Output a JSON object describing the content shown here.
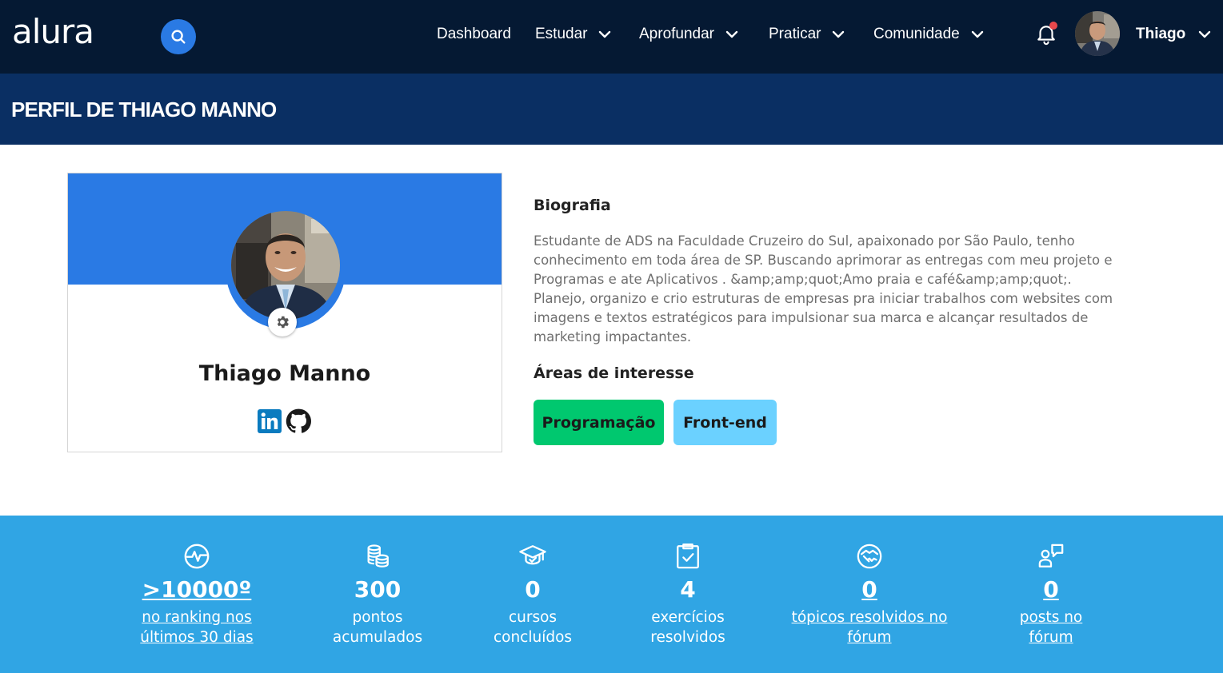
{
  "nav": {
    "logo": "alura",
    "items": [
      {
        "label": "Dashboard"
      },
      {
        "label": "Estudar"
      },
      {
        "label": "Aprofundar"
      },
      {
        "label": "Praticar"
      },
      {
        "label": "Comunidade"
      }
    ],
    "user_name": "Thiago",
    "has_notification": true
  },
  "page": {
    "title": "PERFIL DE THIAGO MANNO"
  },
  "profile": {
    "name": "Thiago Manno",
    "bio_heading": "Biografia",
    "bio": "Estudante de ADS na Faculdade Cruzeiro do Sul, apaixonado por São Paulo, tenho conhecimento em toda área de SP. Buscando aprimorar as entregas com meu projeto e Programas e ate Aplicativos . &amp;amp;quot;Amo praia e café&amp;amp;quot;. Planejo, organizo e crio estruturas de empresas pra iniciar trabalhos com websites com imagens e textos estratégicos para impulsionar sua marca e alcançar resultados de marketing impactantes.",
    "interests_heading": "Áreas de interesse",
    "interests": [
      "Programação",
      "Front-end"
    ]
  },
  "stats": [
    {
      "icon": "activity-icon",
      "value": ">10000º",
      "label_line1": "no ranking nos",
      "label_line2": "últimos 30 dias",
      "link": true
    },
    {
      "icon": "coins-icon",
      "value": "300",
      "label_line1": "pontos",
      "label_line2": "acumulados",
      "link": false
    },
    {
      "icon": "graduation-cap-icon",
      "value": "0",
      "label_line1": "cursos",
      "label_line2": "concluídos",
      "link": false
    },
    {
      "icon": "clipboard-check-icon",
      "value": "4",
      "label_line1": "exercícios",
      "label_line2": "resolvidos",
      "link": false
    },
    {
      "icon": "handshake-icon",
      "value": "0",
      "label_line1": "tópicos resolvidos no",
      "label_line2": "fórum",
      "link": true
    },
    {
      "icon": "user-post-icon",
      "value": "0",
      "label_line1": "posts no",
      "label_line2": "fórum",
      "link": true
    }
  ],
  "colors": {
    "nav_bg": "#051933",
    "title_band": "#0a2f63",
    "accent_blue": "#2a7ae4",
    "stats_bg": "#30a5e4",
    "tag_green": "#00c86f",
    "tag_light_blue": "#6bd1ff",
    "notification_dot": "#e8484c"
  }
}
